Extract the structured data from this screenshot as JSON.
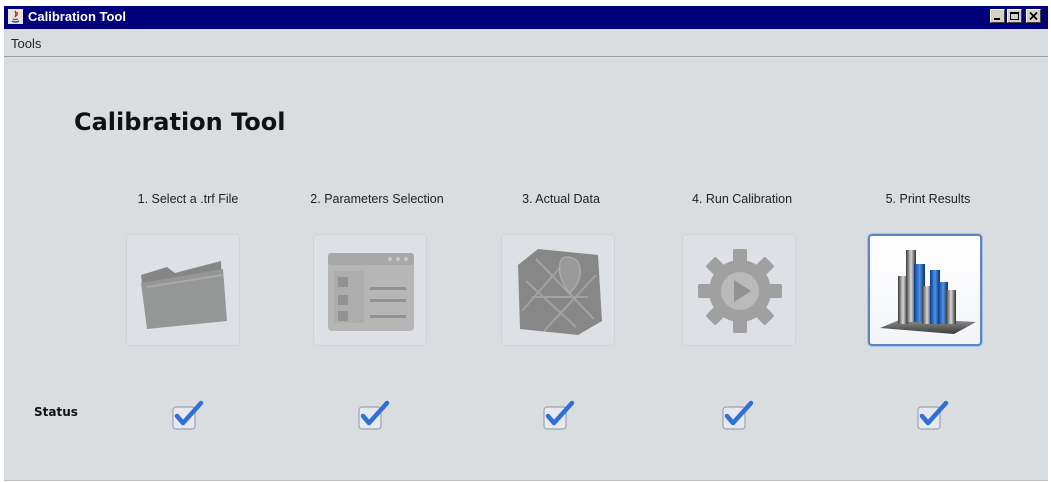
{
  "window": {
    "title": "Calibration Tool"
  },
  "menu": {
    "items": [
      {
        "label": "Tools"
      }
    ]
  },
  "main": {
    "heading": "Calibration Tool",
    "steps": [
      {
        "label": "1. Select a .trf File",
        "icon": "folder-icon",
        "state": "disabled"
      },
      {
        "label": "2. Parameters Selection",
        "icon": "form-checklist-icon",
        "state": "disabled"
      },
      {
        "label": "3. Actual Data",
        "icon": "map-icon",
        "state": "disabled"
      },
      {
        "label": "4. Run Calibration",
        "icon": "gear-play-icon",
        "state": "disabled"
      },
      {
        "label": "5. Print Results",
        "icon": "bar-chart-icon",
        "state": "active"
      }
    ],
    "status": {
      "label": "Status",
      "checks": [
        true,
        true,
        true,
        true,
        true
      ]
    }
  },
  "colors": {
    "titlebar": "#00007b",
    "background": "#d9dde0",
    "active_border": "#5b86c3",
    "check_blue": "#2f6fd6"
  }
}
